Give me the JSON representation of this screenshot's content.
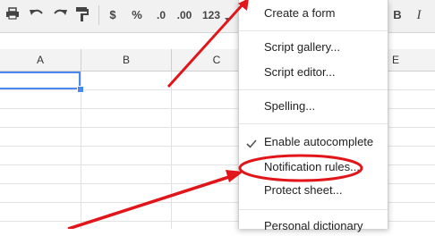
{
  "toolbar": {
    "currency_label": "$",
    "percent_label": "%",
    "decrease_decimals_label": ".0",
    "increase_decimals_label": ".00",
    "more_formats_label": "123",
    "bold_label": "B",
    "italic_label": "I"
  },
  "columns": [
    "A",
    "B",
    "C",
    "E"
  ],
  "menu": {
    "items": [
      {
        "label": "Create a form"
      },
      {
        "label": "Script gallery..."
      },
      {
        "label": "Script editor..."
      },
      {
        "label": "Spelling..."
      },
      {
        "label": "Enable autocomplete",
        "checked": true
      },
      {
        "label": "Notification rules..."
      },
      {
        "label": "Protect sheet..."
      },
      {
        "label": "Personal dictionary"
      }
    ]
  },
  "icons": {
    "print": "print-icon",
    "undo": "undo-icon",
    "redo": "redo-icon",
    "paint_format": "paint-format-icon",
    "dropdown": "chevron-down-icon",
    "check": "check-icon"
  },
  "colors": {
    "selection": "#4a87ee",
    "annotation": "#e0161b"
  }
}
